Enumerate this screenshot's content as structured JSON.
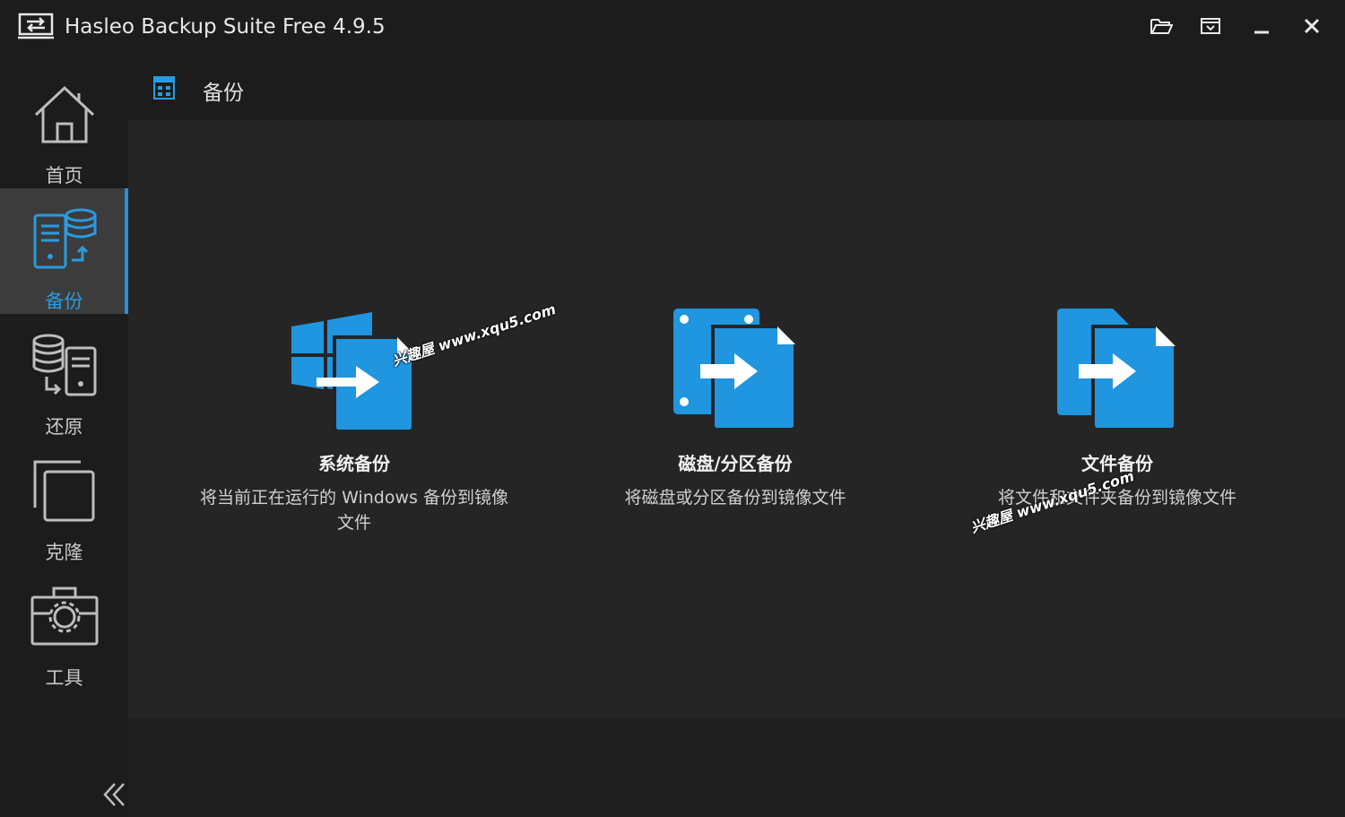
{
  "window": {
    "title": "Hasleo Backup Suite Free 4.9.5"
  },
  "sidebar": {
    "items": [
      {
        "label": "首页",
        "icon": "home-icon"
      },
      {
        "label": "备份",
        "icon": "backup-icon",
        "active": true
      },
      {
        "label": "还原",
        "icon": "restore-icon"
      },
      {
        "label": "克隆",
        "icon": "clone-icon"
      },
      {
        "label": "工具",
        "icon": "tools-icon"
      }
    ]
  },
  "header": {
    "title": "备份",
    "icon": "grid-icon"
  },
  "cards": [
    {
      "title": "系统备份",
      "desc": "将当前正在运行的 Windows 备份到镜像文件",
      "icon": "system-backup-icon"
    },
    {
      "title": "磁盘/分区备份",
      "desc": "将磁盘或分区备份到镜像文件",
      "icon": "disk-backup-icon"
    },
    {
      "title": "文件备份",
      "desc": "将文件和文件夹备份到镜像文件",
      "icon": "file-backup-icon"
    }
  ],
  "watermark": "兴趣屋 www.xqu5.com",
  "colors": {
    "accent": "#2a9be0",
    "icon_blue": "#1f96df",
    "background": "#252525"
  }
}
